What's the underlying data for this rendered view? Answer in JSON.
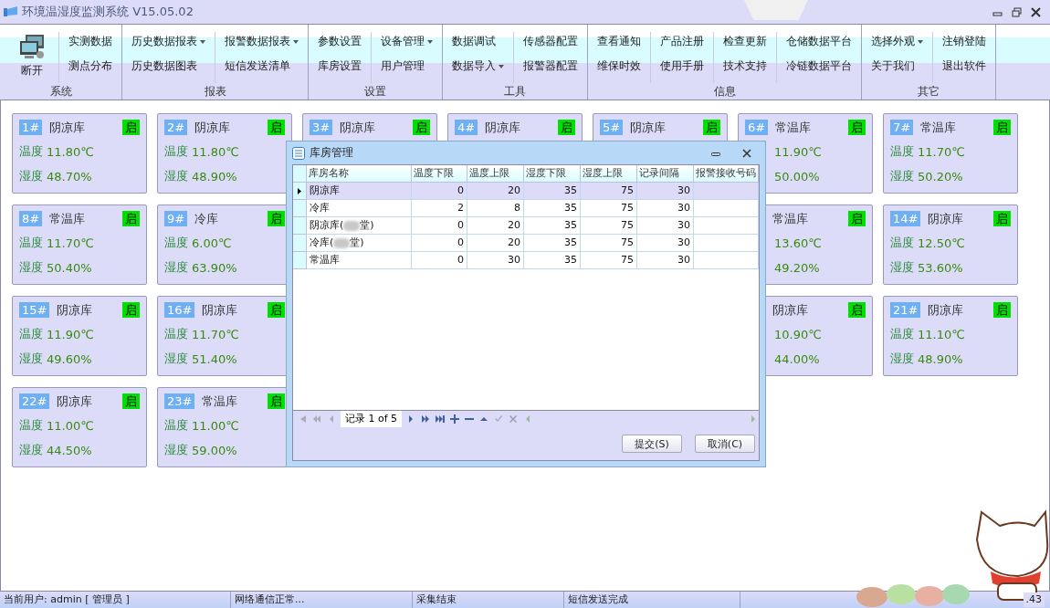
{
  "window": {
    "title": "环境温湿度监测系统 V15.05.02"
  },
  "ribbon": {
    "groups": [
      {
        "label": "系统",
        "big": {
          "label": "断开"
        },
        "columns": [
          [
            {
              "label": "实测数据",
              "dropdown": false
            },
            {
              "label": "测点分布",
              "dropdown": false
            }
          ]
        ]
      },
      {
        "label": "报表",
        "columns": [
          [
            {
              "label": "历史数据报表",
              "dropdown": true
            },
            {
              "label": "历史数据图表",
              "dropdown": false
            }
          ],
          [
            {
              "label": "报警数据报表",
              "dropdown": true
            },
            {
              "label": "短信发送清单",
              "dropdown": false
            }
          ]
        ]
      },
      {
        "label": "设置",
        "columns": [
          [
            {
              "label": "参数设置",
              "dropdown": false
            },
            {
              "label": "库房设置",
              "dropdown": false
            }
          ],
          [
            {
              "label": "设备管理",
              "dropdown": true
            },
            {
              "label": "用户管理",
              "dropdown": false
            }
          ]
        ]
      },
      {
        "label": "工具",
        "columns": [
          [
            {
              "label": "数据调试",
              "dropdown": false
            },
            {
              "label": "数据导入",
              "dropdown": true
            }
          ],
          [
            {
              "label": "传感器配置",
              "dropdown": false
            },
            {
              "label": "报警器配置",
              "dropdown": false
            }
          ]
        ]
      },
      {
        "label": "信息",
        "columns": [
          [
            {
              "label": "查看通知",
              "dropdown": false
            },
            {
              "label": "维保时效",
              "dropdown": false
            }
          ],
          [
            {
              "label": "产品注册",
              "dropdown": false
            },
            {
              "label": "使用手册",
              "dropdown": false
            }
          ],
          [
            {
              "label": "检查更新",
              "dropdown": false
            },
            {
              "label": "技术支持",
              "dropdown": false
            }
          ],
          [
            {
              "label": "仓储数据平台",
              "dropdown": false
            },
            {
              "label": "冷链数据平台",
              "dropdown": false
            }
          ]
        ]
      },
      {
        "label": "其它",
        "columns": [
          [
            {
              "label": "选择外观",
              "dropdown": true
            },
            {
              "label": "关于我们",
              "dropdown": false
            }
          ],
          [
            {
              "label": "注销登陆",
              "dropdown": false
            },
            {
              "label": "退出软件",
              "dropdown": false
            }
          ]
        ]
      }
    ]
  },
  "card_rows": [
    {
      "left": [
        {
          "num": "1#",
          "name": "阴凉库",
          "on": true,
          "badge": "启",
          "temp_label": "温度",
          "temp": "11.80℃",
          "hum_label": "湿度",
          "hum": "48.70%"
        },
        {
          "num": "2#",
          "name": "阴凉库",
          "on": true,
          "badge": "启",
          "temp_label": "温度",
          "temp": "11.80℃",
          "hum_label": "湿度",
          "hum": "48.90%"
        },
        {
          "num": "3#",
          "name": "阴凉库",
          "on": true,
          "badge": "启"
        },
        {
          "num": "4#",
          "name": "阴凉库",
          "on": true,
          "badge": "启"
        },
        {
          "num": "5#",
          "name": "阴凉库",
          "on": true,
          "badge": "启"
        },
        {
          "num": "6#",
          "name": "常温库",
          "on": true,
          "badge": "启",
          "temp": "11.90℃",
          "hum": "50.00%"
        },
        {
          "num": "7#",
          "name": "常温库",
          "on": true,
          "badge": "启",
          "temp_label": "温度",
          "temp": "11.70℃",
          "hum_label": "湿度",
          "hum": "50.20%"
        }
      ]
    },
    {
      "left": [
        {
          "num": "8#",
          "name": "常温库",
          "on": true,
          "badge": "启",
          "temp_label": "温度",
          "temp": "11.70℃",
          "hum_label": "湿度",
          "hum": "50.40%"
        },
        {
          "num": "9#",
          "name": "冷库",
          "on": true,
          "badge": "启",
          "temp_label": "温度",
          "temp": "6.00℃",
          "hum_label": "湿度",
          "hum": "63.90%"
        }
      ],
      "right": [
        {
          "name": "常温库",
          "on": true,
          "badge": "启",
          "temp": "13.60℃",
          "hum": "49.20%"
        },
        {
          "num": "14#",
          "name": "阴凉库",
          "on": true,
          "badge": "启",
          "temp_label": "温度",
          "temp": "12.50℃",
          "hum_label": "湿度",
          "hum": "53.60%"
        }
      ]
    },
    {
      "left": [
        {
          "num": "15#",
          "name": "阴凉库",
          "on": true,
          "badge": "启",
          "temp_label": "温度",
          "temp": "11.90℃",
          "hum_label": "湿度",
          "hum": "49.60%"
        },
        {
          "num": "16#",
          "name": "阴凉库",
          "on": true,
          "badge": "启",
          "temp_label": "温度",
          "temp": "11.70℃",
          "hum_label": "湿度",
          "hum": "51.40%"
        }
      ],
      "right": [
        {
          "name": "阴凉库",
          "on": true,
          "badge": "启",
          "temp": "10.90℃",
          "hum": "44.00%"
        },
        {
          "num": "21#",
          "name": "阴凉库",
          "on": true,
          "badge": "启",
          "temp_label": "温度",
          "temp": "11.10℃",
          "hum_label": "湿度",
          "hum": "48.90%"
        }
      ]
    },
    {
      "left": [
        {
          "num": "22#",
          "name": "阴凉库",
          "on": true,
          "badge": "启",
          "temp_label": "温度",
          "temp": "11.00℃",
          "hum_label": "湿度",
          "hum": "44.50%"
        },
        {
          "num": "23#",
          "name": "常温库",
          "on": true,
          "badge": "启",
          "temp_label": "温度",
          "temp": "11.00℃",
          "hum_label": "湿度",
          "hum": "59.00%"
        }
      ]
    }
  ],
  "dialog": {
    "title": "库房管理",
    "columns": [
      "库房名称",
      "温度下限",
      "温度上限",
      "湿度下限",
      "湿度上限",
      "记录间隔",
      "报警接收号码"
    ],
    "rows": [
      {
        "selected": true,
        "name": "阴凉库",
        "cells": [
          "0",
          "20",
          "35",
          "75",
          "30"
        ]
      },
      {
        "selected": false,
        "name": "冷库",
        "cells": [
          "2",
          "8",
          "35",
          "75",
          "30"
        ]
      },
      {
        "selected": false,
        "name": "阴凉库(",
        "blurred": true,
        "name_tail": "堂)",
        "cells": [
          "0",
          "20",
          "35",
          "75",
          "30"
        ]
      },
      {
        "selected": false,
        "name": "冷库(",
        "blurred": true,
        "name_tail": "堂)",
        "cells": [
          "0",
          "20",
          "35",
          "75",
          "30"
        ]
      },
      {
        "selected": false,
        "name": "常温库",
        "cells": [
          "0",
          "30",
          "35",
          "75",
          "30"
        ]
      }
    ],
    "navigator": {
      "record": "记录 1 of 5"
    },
    "buttons": [
      "提交(S)",
      "取消(C)"
    ]
  },
  "status_bar": [
    "当前用户: admin [ 管理员 ]",
    "网络通信正常...",
    "采集结束",
    "短信发送完成",
    ".43"
  ]
}
